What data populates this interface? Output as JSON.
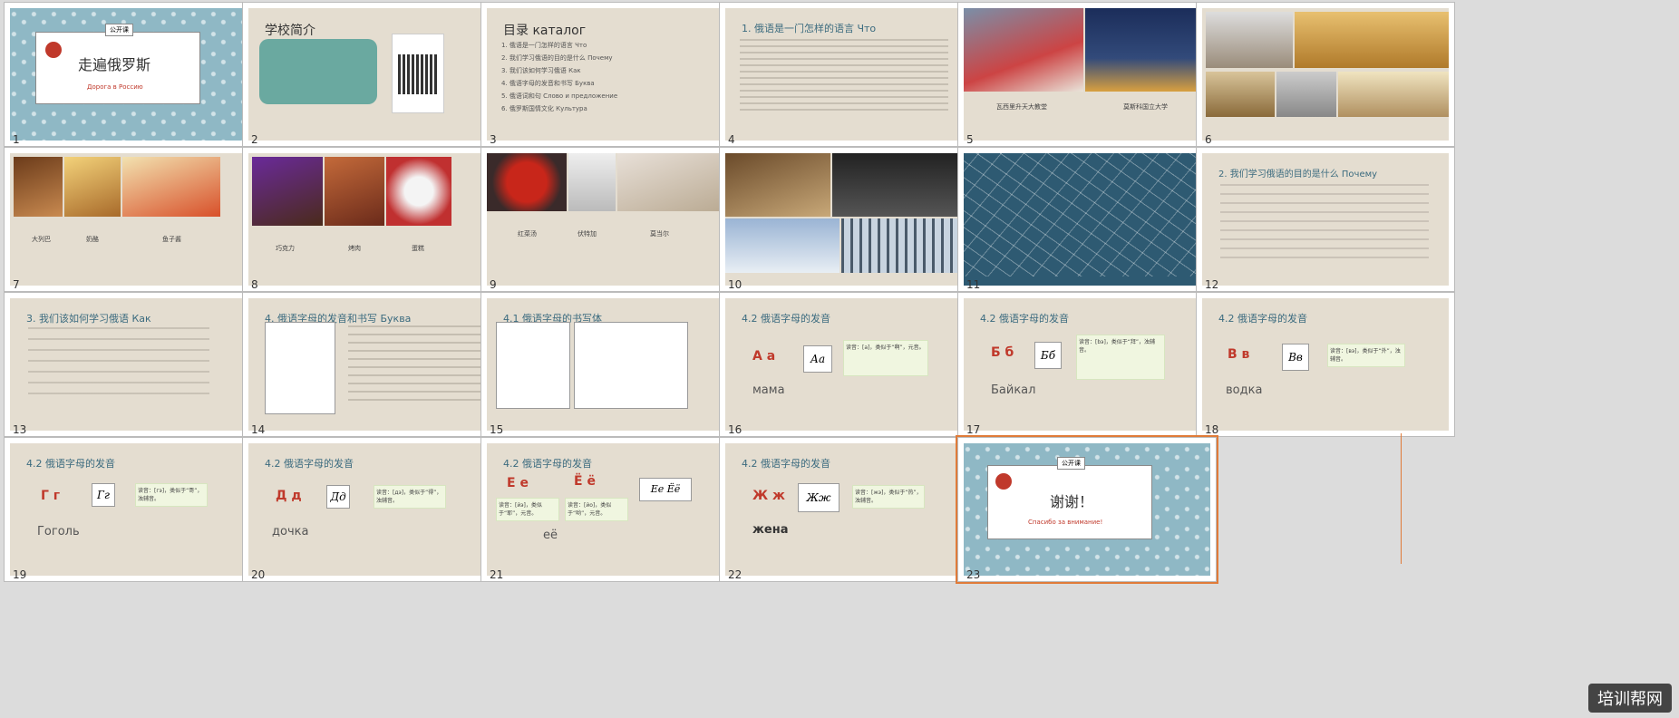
{
  "slides": [
    {
      "n": "1",
      "badge": "公开课",
      "title": "走遍俄罗斯",
      "subtitle": "Дорога в Россию"
    },
    {
      "n": "2",
      "title": "学校简介"
    },
    {
      "n": "3",
      "title": "目录 каталог",
      "items": [
        "1. 俄语是一门怎样的语言 Что",
        "2. 我们学习俄语的目的是什么 Почему",
        "3. 我们该如何学习俄语 Как",
        "4. 俄语字母的发音和书写 Буква",
        "5. 俄语词和句 Слово и предложение",
        "6. 俄罗斯国情文化 Культура"
      ]
    },
    {
      "n": "4",
      "title": "1. 俄语是一门怎样的语言 Что"
    },
    {
      "n": "5",
      "captions": [
        "瓦西里升天大教堂",
        "莫斯科国立大学"
      ]
    },
    {
      "n": "6"
    },
    {
      "n": "7",
      "captions": [
        "大列巴",
        "奶酪",
        "鱼子酱"
      ]
    },
    {
      "n": "8",
      "captions": [
        "巧克力",
        "烤肉",
        "蛋糕"
      ]
    },
    {
      "n": "9",
      "captions": [
        "红菜汤",
        "伏特加",
        "莫当尔"
      ]
    },
    {
      "n": "10"
    },
    {
      "n": "11"
    },
    {
      "n": "12",
      "title": "2. 我们学习俄语的目的是什么 Почему"
    },
    {
      "n": "13",
      "title": "3. 我们该如何学习俄语 Как"
    },
    {
      "n": "14",
      "title": "4. 俄语字母的发音和书写 Буква"
    },
    {
      "n": "15",
      "title": "4.1 俄语字母的书写体"
    },
    {
      "n": "16",
      "title": "4.2 俄语字母的发音",
      "letter": "А а",
      "script": "Аа",
      "word": "мама",
      "note": "读音：[a]，类似于“啊”，元音。"
    },
    {
      "n": "17",
      "title": "4.2 俄语字母的发音",
      "letter": "Б б",
      "script": "Бб",
      "word": "Байкал",
      "note": "读音：[bэ]，类似于“拜”，浊辅音。"
    },
    {
      "n": "18",
      "title": "4.2 俄语字母的发音",
      "letter": "В в",
      "script": "Вв",
      "word": "водка",
      "note": "读音：[вэ]，类似于“外”，浊辅音。"
    },
    {
      "n": "19",
      "title": "4.2 俄语字母的发音",
      "letter": "Г г",
      "script": "Гг",
      "word": "Гоголь",
      "note": "读音：[гэ]，类似于“哥”，浊辅音。"
    },
    {
      "n": "20",
      "title": "4.2 俄语字母的发音",
      "letter": "Д д",
      "script": "Дд",
      "word": "дочка",
      "note": "读音：[дэ]，类似于“得”，浊辅音。"
    },
    {
      "n": "21",
      "title": "4.2 俄语字母的发音",
      "letter1": "Е е",
      "letter2": "Ё ё",
      "script": "Ее Ёё",
      "word": "её",
      "note1": "读音：[йэ]，类似于“耶”，元音。",
      "note2": "读音：[йо]，类似于“哟”，元音。"
    },
    {
      "n": "22",
      "title": "4.2 俄语字母的发音",
      "letter": "Ж ж",
      "script": "Жж",
      "word": "жена",
      "note": "读音：[жэ]，类似于“热”，浊辅音。"
    },
    {
      "n": "23",
      "badge": "公开课",
      "title": "谢谢！",
      "subtitle": "Спасибо за внимание!"
    }
  ],
  "watermark": "培训帮网"
}
